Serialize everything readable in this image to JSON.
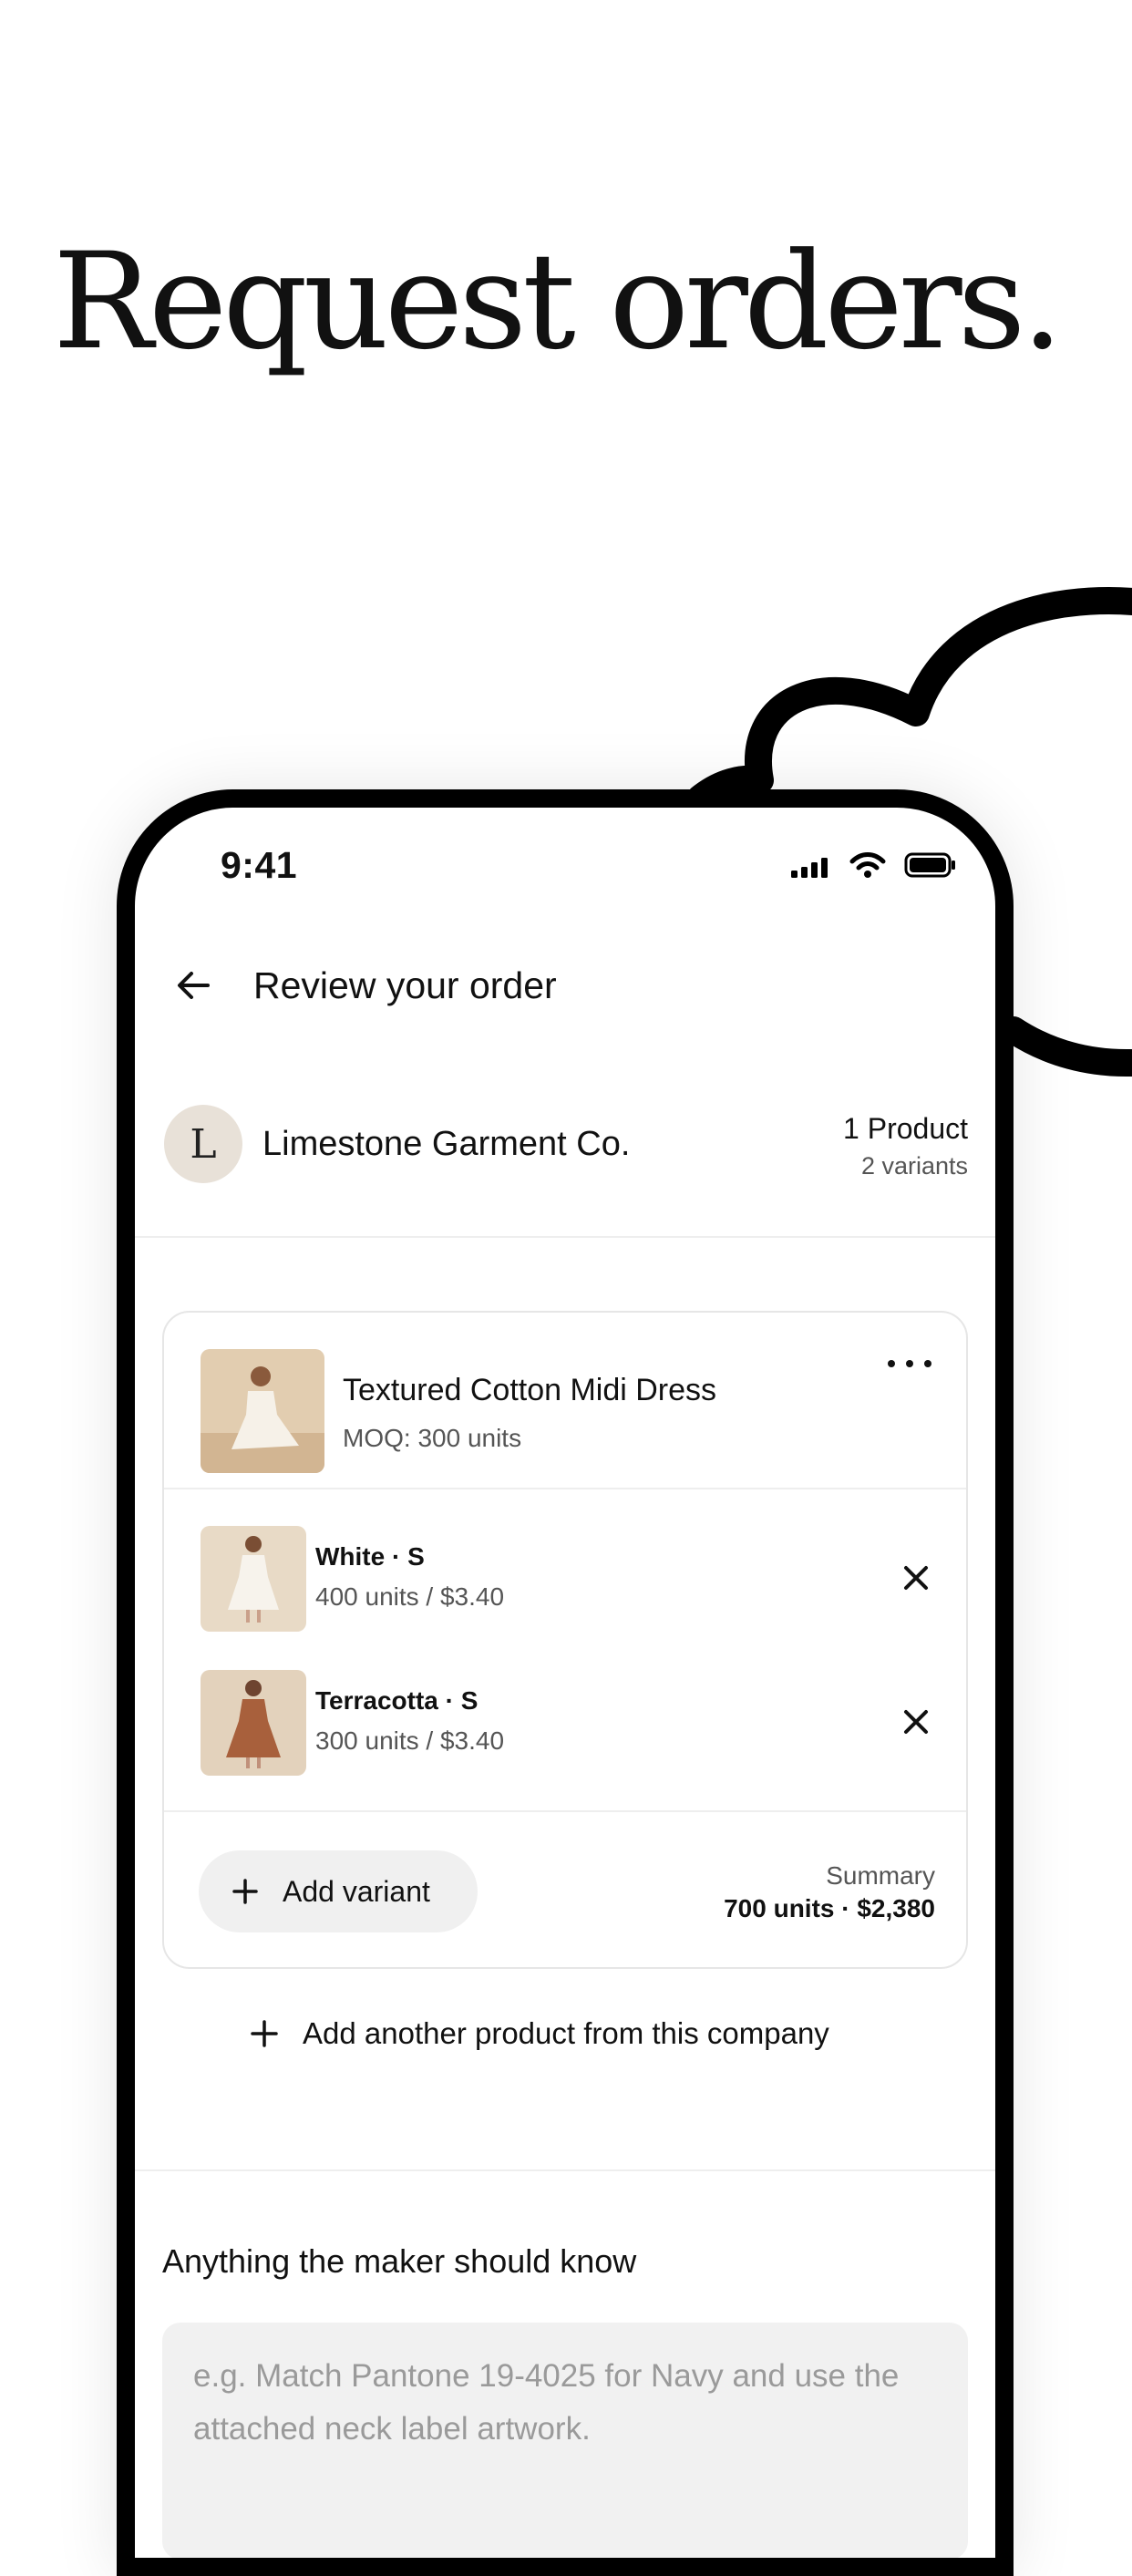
{
  "headline": "Request orders.",
  "status_bar": {
    "time": "9:41"
  },
  "nav": {
    "title": "Review your order"
  },
  "company": {
    "initial": "L",
    "name": "Limestone Garment Co.",
    "product_count": "1 Product",
    "variant_count": "2 variants"
  },
  "product": {
    "name": "Textured Cotton Midi Dress",
    "moq": "MOQ: 300 units",
    "variants": [
      {
        "name": "White · S",
        "detail": "400 units / $3.40"
      },
      {
        "name": "Terracotta · S",
        "detail": "300 units / $3.40"
      }
    ],
    "add_variant_label": "Add variant",
    "summary_label": "Summary",
    "summary_value": "700 units · $2,380"
  },
  "add_product_label": "Add another product from this company",
  "notes": {
    "heading": "Anything the maker should know",
    "placeholder": "e.g. Match Pantone 19-4025 for Navy and use the attached neck label artwork."
  },
  "colors": {
    "text": "#111111",
    "muted": "#555555",
    "placeholder": "#9a9a9a",
    "input_bg": "#f1f1f1",
    "avatar_bg": "#e8e1d8",
    "dress_white": "#f4efe6",
    "dress_terracotta": "#a8603c"
  }
}
